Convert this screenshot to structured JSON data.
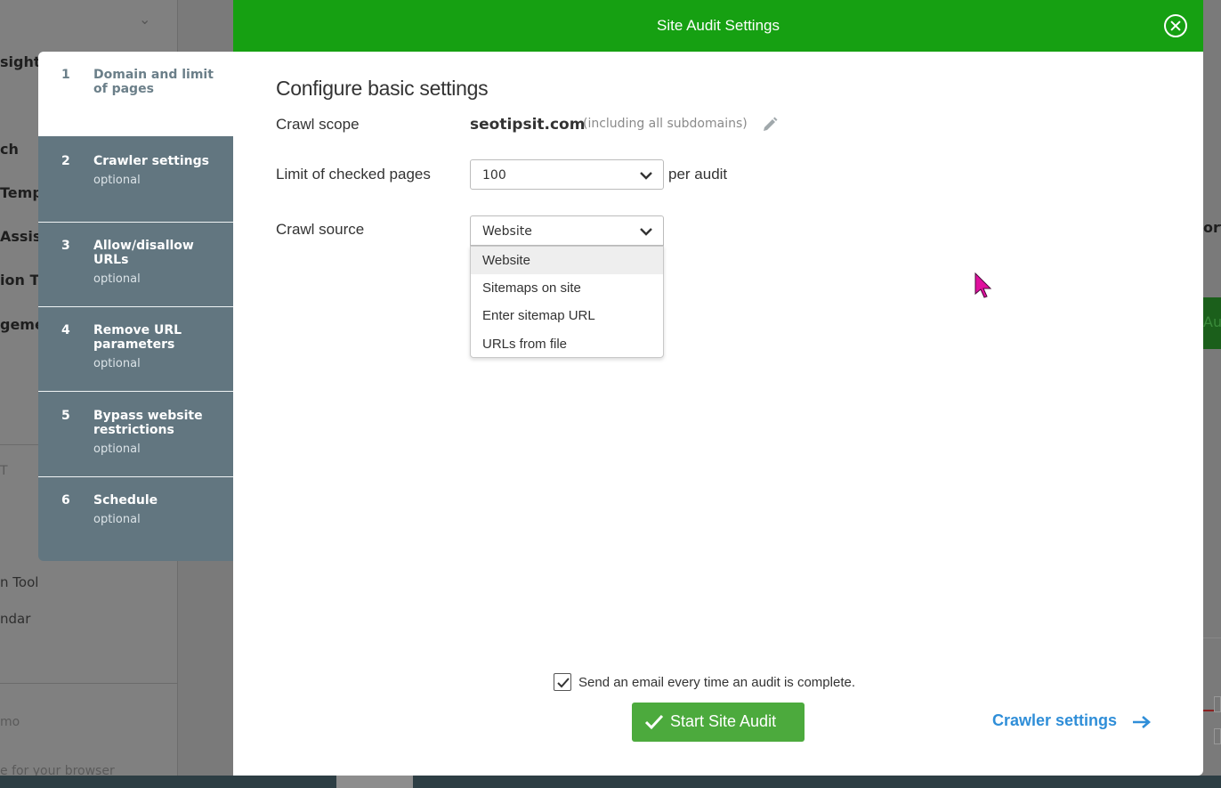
{
  "background": {
    "sidebar_fragments": [
      "sights",
      "ch",
      "Temp",
      "Assist",
      "ion T",
      "geme",
      "T",
      "n Tool",
      "ndar",
      "mo",
      "e for your browser"
    ],
    "right_fragments": [
      "ort",
      "Au"
    ]
  },
  "steps": [
    {
      "num": "1",
      "title": "Domain and limit of pages",
      "optional": ""
    },
    {
      "num": "2",
      "title": "Crawler settings",
      "optional": "optional"
    },
    {
      "num": "3",
      "title": "Allow/disallow URLs",
      "optional": "optional"
    },
    {
      "num": "4",
      "title": "Remove URL parameters",
      "optional": "optional"
    },
    {
      "num": "5",
      "title": "Bypass website restrictions",
      "optional": "optional"
    },
    {
      "num": "6",
      "title": "Schedule",
      "optional": "optional"
    }
  ],
  "modal": {
    "title": "Site Audit Settings",
    "heading": "Configure basic settings",
    "crawl_scope_label": "Crawl scope",
    "domain": "seotipsit.com",
    "domain_note": "(including all subdomains)",
    "limit_label": "Limit of checked pages",
    "limit_value": "100",
    "per_audit": "per audit",
    "source_label": "Crawl source",
    "source_value": "Website",
    "source_options": [
      "Website",
      "Sitemaps on site",
      "Enter sitemap URL",
      "URLs from file"
    ],
    "email_label": "Send an email every time an audit is complete.",
    "email_checked": true,
    "start_button": "Start Site Audit",
    "next_link": "Crawler settings"
  },
  "colors": {
    "header_green": "#16a012",
    "button_green": "#4caa3d",
    "link_blue": "#2f8ed8",
    "steps_bg": "#627680",
    "cursor_magenta": "#e0109e"
  }
}
